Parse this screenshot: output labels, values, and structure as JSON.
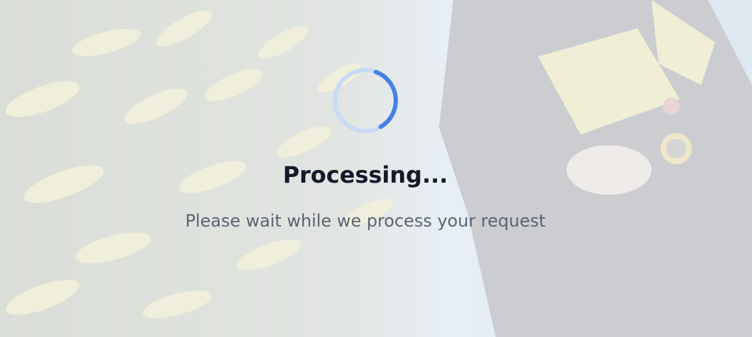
{
  "overlay": {
    "title": "Processing...",
    "message": "Please wait while we process your request"
  },
  "spinner": {
    "icon": "loading-spinner-icon",
    "track_color": "#c8daf6",
    "arc_color": "#4a80e6"
  },
  "background": {
    "description_icon": "underwater-photo",
    "veil_color": "#f8fafc"
  }
}
